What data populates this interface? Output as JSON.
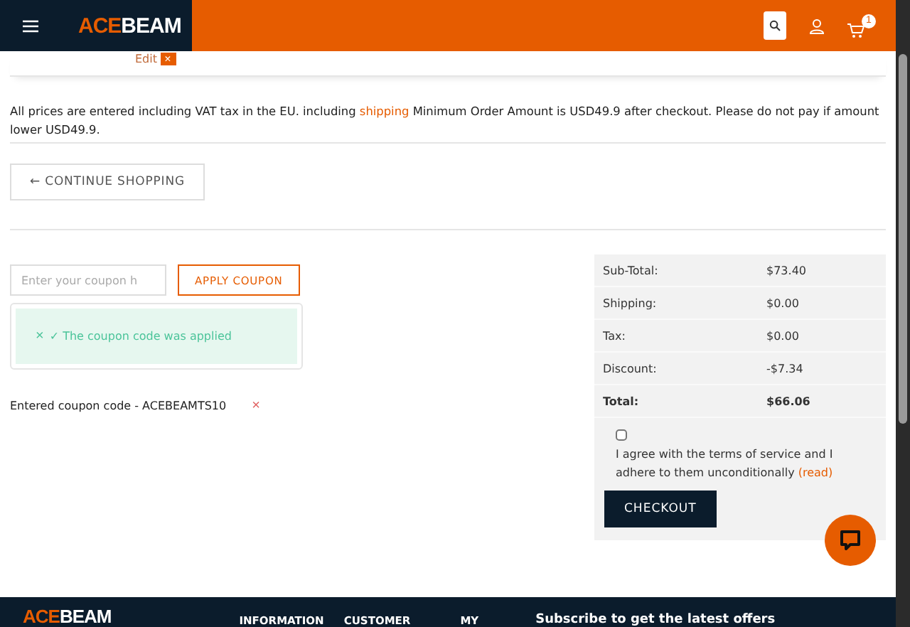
{
  "header": {
    "logo": {
      "accent": "ACE",
      "rest": "BEAM"
    },
    "cart_count": "1"
  },
  "edit_strip": {
    "label": "Edit",
    "remove": "×"
  },
  "notice": {
    "before": "All prices are entered including VAT tax in the EU. including",
    "link": "shipping",
    "after": "Minimum Order Amount is USD49.9 after checkout. Please do not pay if amount lower USD49.9."
  },
  "continue_button": "← CONTINUE SHOPPING",
  "coupon": {
    "placeholder": "Enter your coupon h",
    "button": "APPLY COUPON",
    "alert_close": "×",
    "message": "✓ The coupon code was applied",
    "entered": "Entered coupon code - ACEBEAMTS10",
    "remove": "×"
  },
  "summary": {
    "rows": [
      {
        "label": "Sub-Total:",
        "value": "$73.40",
        "kind": "normal"
      },
      {
        "label": "Shipping:",
        "value": "$0.00",
        "kind": "normal"
      },
      {
        "label": "Tax:",
        "value": "$0.00",
        "kind": "normal"
      },
      {
        "label": "Discount:",
        "value": "-$7.34",
        "kind": "normal"
      },
      {
        "label": "Total:",
        "value": "$66.06",
        "kind": "total"
      }
    ],
    "terms": {
      "checked": false,
      "text": "I agree with the terms of service and I adhere to them unconditionally",
      "link": "(read)"
    },
    "checkout": "CHECKOUT"
  },
  "footer": {
    "logo": {
      "accent": "ACE",
      "rest": "BEAM"
    },
    "columns": [
      "INFORMATION",
      "CUSTOMER",
      "MY"
    ],
    "subscribe": "Subscribe to get the latest offers"
  }
}
